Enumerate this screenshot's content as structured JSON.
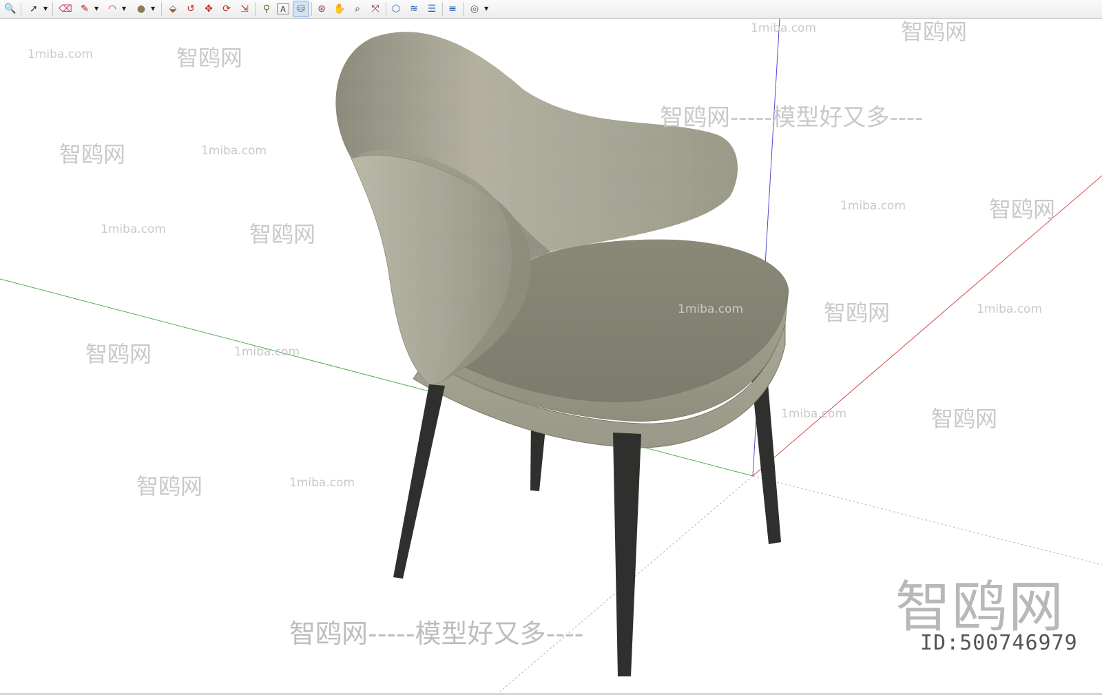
{
  "toolbar": {
    "tools": [
      {
        "name": "zoom-icon",
        "glyph": "🔍"
      },
      {
        "name": "select-icon",
        "glyph": "➚"
      },
      {
        "name": "eraser-icon",
        "glyph": "⌫"
      },
      {
        "name": "pencil-icon",
        "glyph": "✎"
      },
      {
        "name": "arc-icon",
        "glyph": "◠"
      },
      {
        "name": "shape-icon",
        "glyph": "●"
      },
      {
        "name": "push-pull-icon",
        "glyph": "⬙"
      },
      {
        "name": "follow-me-icon",
        "glyph": "↺"
      },
      {
        "name": "move-icon",
        "glyph": "✥"
      },
      {
        "name": "rotate-icon",
        "glyph": "⟳"
      },
      {
        "name": "scale-icon",
        "glyph": "⇲"
      },
      {
        "name": "tape-measure-icon",
        "glyph": "⚲"
      },
      {
        "name": "text-icon",
        "glyph": "A"
      },
      {
        "name": "paint-bucket-icon",
        "glyph": "⛁"
      },
      {
        "name": "orbit-icon",
        "glyph": "⊛"
      },
      {
        "name": "pan-icon",
        "glyph": "✋"
      },
      {
        "name": "zoom-window-icon",
        "glyph": "⌕"
      },
      {
        "name": "zoom-extents-icon",
        "glyph": "⤧"
      },
      {
        "name": "components-icon",
        "glyph": "⬡"
      },
      {
        "name": "section-plane-icon",
        "glyph": "≋"
      },
      {
        "name": "layers-icon",
        "glyph": "☰"
      },
      {
        "name": "styles-icon",
        "glyph": "≡"
      },
      {
        "name": "account-icon",
        "glyph": "◎"
      }
    ],
    "active_tool": "paint-bucket-icon"
  },
  "watermarks": {
    "site": "1miba.com",
    "brand": "智鸥网",
    "slogan": "智鸥网-----模型好又多----",
    "big_brand": "智鸥网",
    "id_text": "ID:500746979"
  },
  "colors": {
    "fabric": "#a19f8d",
    "fabric_dark": "#7f7d6c",
    "legs": "#2f2f2e",
    "axis_red": "#d24a4a",
    "axis_green": "#4caf50",
    "axis_blue": "#4a4ad2"
  }
}
